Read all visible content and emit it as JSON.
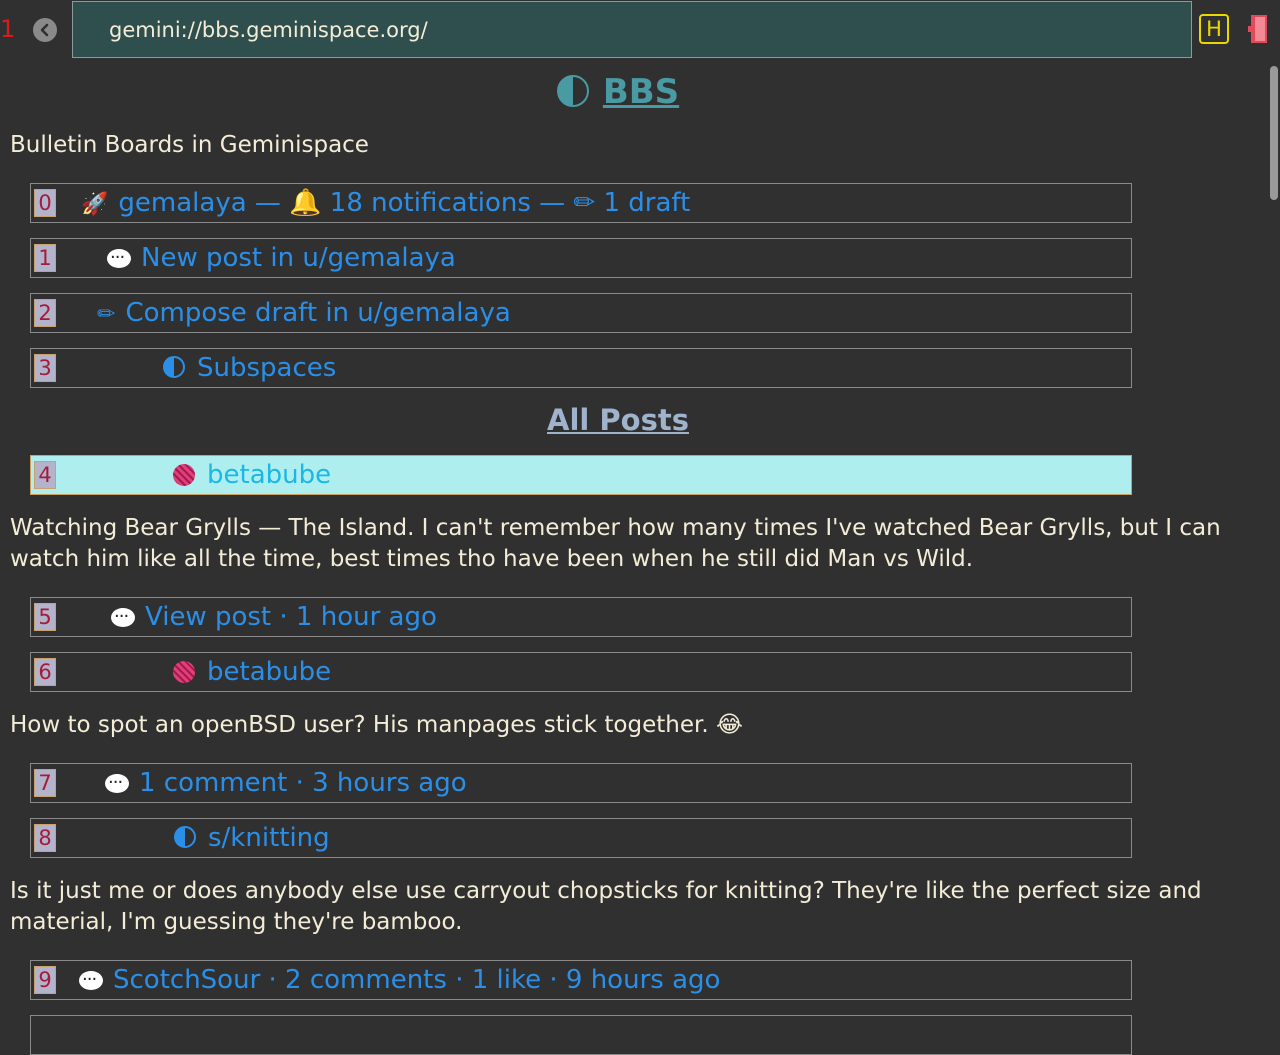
{
  "browser": {
    "tab_count": "1",
    "url": "gemini://bbs.geminispace.org/",
    "history_label": "H",
    "colors": {
      "hint_text": "#a51c3a",
      "link": "#2b8fe8",
      "url_bg": "#2f4f4f"
    }
  },
  "page": {
    "title": "BBS",
    "subtitle": "Bulletin Boards in Geminispace",
    "nav_links": [
      {
        "hint": "0",
        "text": "gemalaya — 🔔 18 notifications — ✏ 1 draft",
        "icon": "rocket-icon"
      },
      {
        "hint": "1",
        "text": "New post in u/gemalaya",
        "icon": "speech-bubble-icon"
      },
      {
        "hint": "2",
        "text": "Compose draft in u/gemalaya",
        "icon": "pencil-icon"
      },
      {
        "hint": "3",
        "text": "Subspaces",
        "icon": "half-moon-icon"
      }
    ],
    "section_heading": "All Posts",
    "posts": [
      {
        "author_hint": "4",
        "author": "betabube",
        "body": "Watching Bear Grylls — The Island. I can't remember how many times I've watched Bear Grylls, but I can watch him like all the time, best times tho have been when he still did Man vs Wild.",
        "meta_hint": "5",
        "meta": "View post · 1 hour ago"
      },
      {
        "author_hint": "6",
        "author": "betabube",
        "body": "How to spot an openBSD user? His manpages stick together. 😂",
        "meta_hint": "7",
        "meta": "1 comment · 3 hours ago"
      },
      {
        "author_hint": "8",
        "author": "s/knitting",
        "body": "Is it just me or does anybody else use carryout chopsticks for knitting? They're like the perfect size and material, I'm guessing they're bamboo.",
        "meta_hint": "9",
        "meta": "ScotchSour · 2 comments · 1 like · 9 hours ago"
      }
    ]
  }
}
